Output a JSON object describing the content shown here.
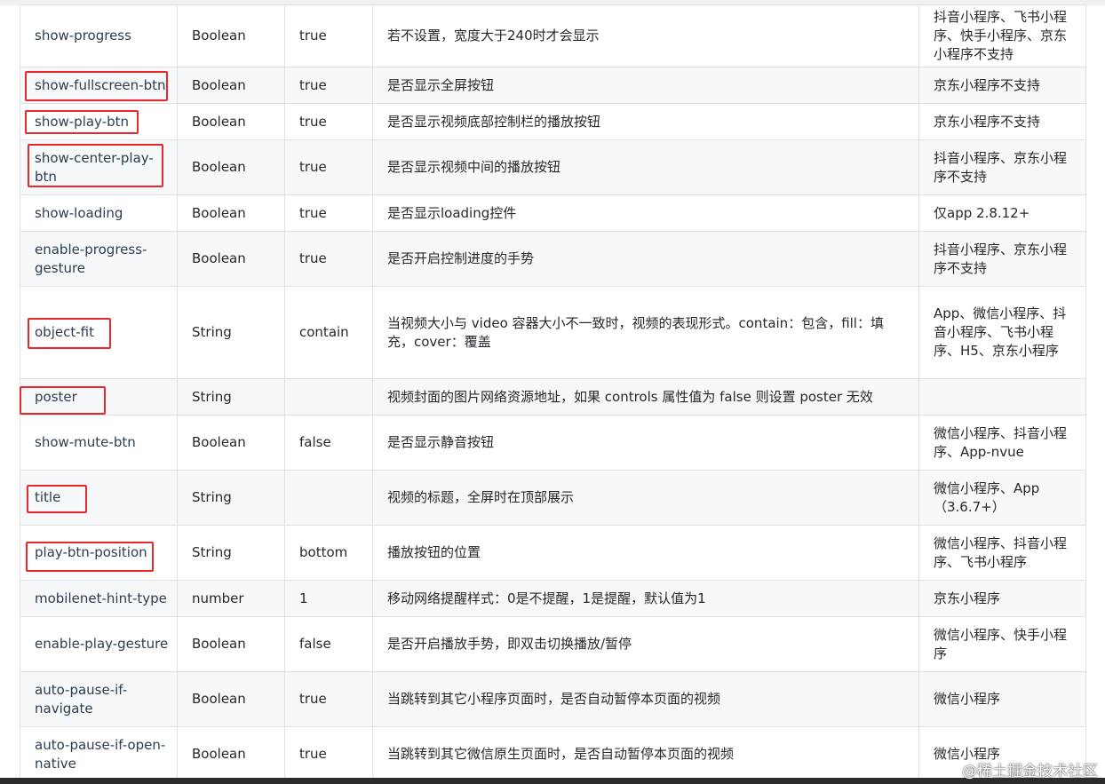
{
  "rows": [
    {
      "name": "show-progress",
      "type": "Boolean",
      "default": "true",
      "desc": "若不设置，宽度大于240时才会显示",
      "platform": "抖音小程序、飞书小程序、快手小程序、京东小程序不支持"
    },
    {
      "name": "show-fullscreen-btn",
      "type": "Boolean",
      "default": "true",
      "desc": "是否显示全屏按钮",
      "platform": "京东小程序不支持"
    },
    {
      "name": "show-play-btn",
      "type": "Boolean",
      "default": "true",
      "desc": "是否显示视频底部控制栏的播放按钮",
      "platform": "京东小程序不支持"
    },
    {
      "name": "show-center-play-btn",
      "type": "Boolean",
      "default": "true",
      "desc": "是否显示视频中间的播放按钮",
      "platform": "抖音小程序、京东小程序不支持"
    },
    {
      "name": "show-loading",
      "type": "Boolean",
      "default": "true",
      "desc": "是否显示loading控件",
      "platform": "仅app 2.8.12+"
    },
    {
      "name": "enable-progress-gesture",
      "type": "Boolean",
      "default": "true",
      "desc": "是否开启控制进度的手势",
      "platform": "抖音小程序、京东小程序不支持"
    },
    {
      "name": "object-fit",
      "type": "String",
      "default": "contain",
      "desc": "当视频大小与 video 容器大小不一致时，视频的表现形式。contain：包含，fill：填充，cover：覆盖",
      "platform": "App、微信小程序、抖音小程序、飞书小程序、H5、京东小程序"
    },
    {
      "name": "poster",
      "type": "String",
      "default": "",
      "desc": "视频封面的图片网络资源地址，如果 controls 属性值为 false 则设置 poster 无效",
      "platform": ""
    },
    {
      "name": "show-mute-btn",
      "type": "Boolean",
      "default": "false",
      "desc": "是否显示静音按钮",
      "platform": "微信小程序、抖音小程序、App-nvue"
    },
    {
      "name": "title",
      "type": "String",
      "default": "",
      "desc": "视频的标题，全屏时在顶部展示",
      "platform": "微信小程序、App（3.6.7+）"
    },
    {
      "name": "play-btn-position",
      "type": "String",
      "default": "bottom",
      "desc": "播放按钮的位置",
      "platform": "微信小程序、抖音小程序、飞书小程序"
    },
    {
      "name": "mobilenet-hint-type",
      "type": "number",
      "default": "1",
      "desc": "移动网络提醒样式：0是不提醒，1是提醒，默认值为1",
      "platform": "京东小程序"
    },
    {
      "name": "enable-play-gesture",
      "type": "Boolean",
      "default": "false",
      "desc": "是否开启播放手势，即双击切换播放/暂停",
      "platform": "微信小程序、快手小程序"
    },
    {
      "name": "auto-pause-if-navigate",
      "type": "Boolean",
      "default": "true",
      "desc": "当跳转到其它小程序页面时，是否自动暂停本页面的视频",
      "platform": "微信小程序"
    },
    {
      "name": "auto-pause-if-open-native",
      "type": "Boolean",
      "default": "true",
      "desc": "当跳转到其它微信原生页面时，是否自动暂停本页面的视频",
      "platform": "微信小程序"
    }
  ],
  "watermark": "@稀土掘金技术社区",
  "colors": {
    "highlight": "#e8282c",
    "border": "#dfe2e5",
    "stripe": "#f6f8fa"
  }
}
